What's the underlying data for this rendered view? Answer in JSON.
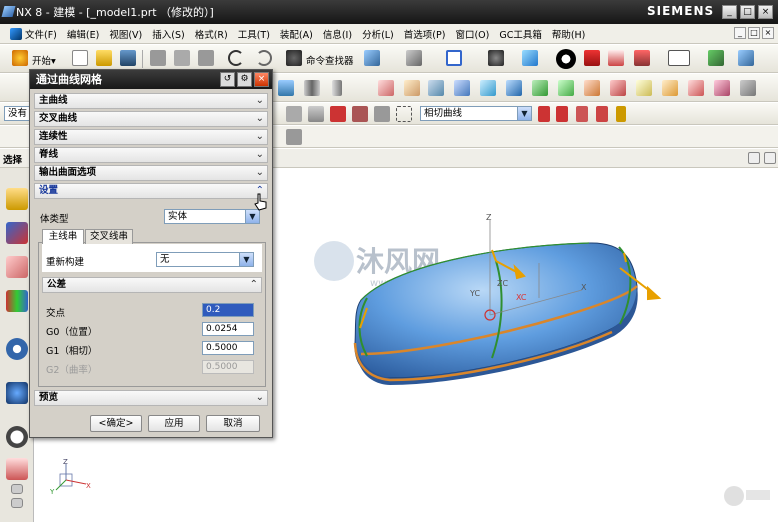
{
  "window": {
    "title": "NX 8 - 建模 - [_model1.prt （修改的）]",
    "brand": "SIEMENS",
    "min": "_",
    "restore": "□",
    "close": "×"
  },
  "menu": [
    "开始▾",
    "文件(F)",
    "编辑(E)",
    "视图(V)",
    "插入(S)",
    "格式(R)",
    "工具(T)",
    "装配(A)",
    "信息(I)",
    "分析(L)",
    "首选项(P)",
    "窗口(O)",
    "GC工具箱",
    "帮助(H)"
  ],
  "toolbar": {
    "start_label": "开始▾",
    "command_finder": "命令查找器",
    "filter_value": "没有",
    "curve_rule": "相切曲线"
  },
  "side_label": "选择",
  "dialog": {
    "title": "通过曲线网格",
    "sections": {
      "primary": "主曲线",
      "cross": "交叉曲线",
      "continuity": "连续性",
      "spine": "脊线",
      "output": "输出曲面选项",
      "settings": "设置",
      "tolerance": "公差",
      "preview": "预览"
    },
    "body_type_label": "体类型",
    "body_type_value": "实体",
    "tabs": [
      "主线串",
      "交叉线串"
    ],
    "rebuild_label": "重新构建",
    "rebuild_value": "无",
    "intersect_label": "交点",
    "intersect_value": "0.2",
    "g0_label": "G0（位置）",
    "g0_value": "0.0254",
    "g1_label": "G1（相切）",
    "g1_value": "0.5000",
    "g2_label": "G2（曲率）",
    "g2_value": "0.5000",
    "buttons": {
      "ok": "<确定>",
      "apply": "应用",
      "cancel": "取消"
    }
  },
  "viewport": {
    "watermark_title": "沐风网",
    "watermark_url": "www.mfcad.com",
    "axis_z": "Z",
    "axis_x": "X",
    "axis_y": "Y",
    "axis_zc": "ZC",
    "axis_yc": "YC",
    "axis_xc": "XC"
  },
  "colors": {
    "surface": "#4f8fd6",
    "curve": "#d9862b",
    "cross_curve": "#2f8f2f",
    "arrow": "#e8a000",
    "titlebar": "#222222",
    "dialog_bg": "#d4d0c8"
  }
}
